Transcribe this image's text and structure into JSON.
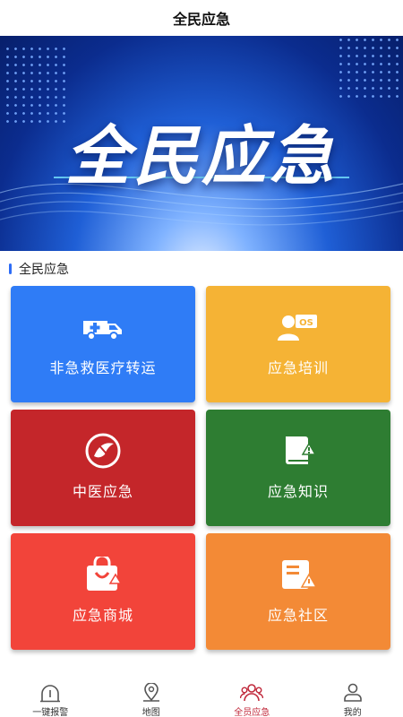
{
  "header": {
    "title": "全民应急"
  },
  "banner": {
    "headline": "全民应急"
  },
  "section": {
    "title": "全民应急"
  },
  "tiles": [
    {
      "label": "非急救医疗转运",
      "color": "#2f7cf6",
      "icon": "ambulance-icon"
    },
    {
      "label": "应急培训",
      "color": "#f5b335",
      "icon": "training-icon"
    },
    {
      "label": "中医应急",
      "color": "#c4262a",
      "icon": "tcm-icon"
    },
    {
      "label": "应急知识",
      "color": "#2e7d32",
      "icon": "knowledge-book-icon"
    },
    {
      "label": "应急商城",
      "color": "#f2443a",
      "icon": "shopping-bag-icon"
    },
    {
      "label": "应急社区",
      "color": "#f38a36",
      "icon": "community-icon"
    }
  ],
  "bottom_nav": [
    {
      "label": "一键报警",
      "icon": "alarm-icon",
      "active": false
    },
    {
      "label": "地图",
      "icon": "map-pin-icon",
      "active": false
    },
    {
      "label": "全员应急",
      "icon": "people-icon",
      "active": true
    },
    {
      "label": "我的",
      "icon": "user-icon",
      "active": false
    }
  ],
  "colors": {
    "accent": "#2d6cf6",
    "active_nav": "#c0283a"
  }
}
